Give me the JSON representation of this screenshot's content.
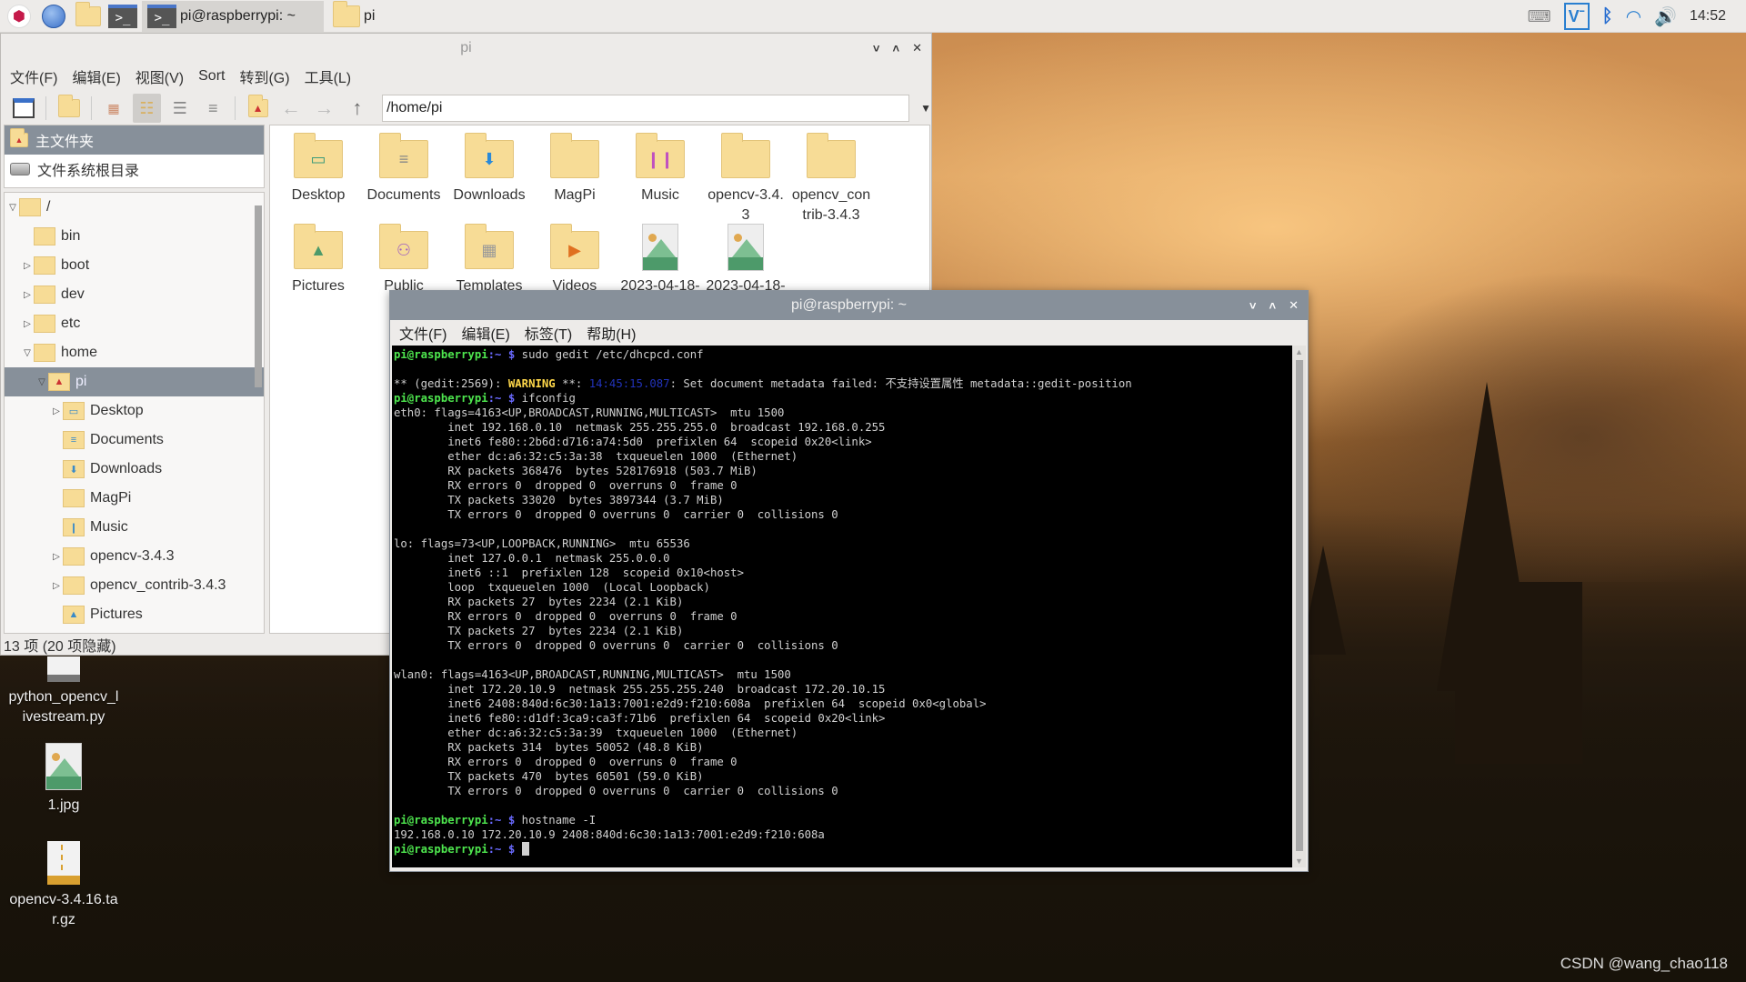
{
  "taskbar": {
    "tasks": [
      {
        "label": "pi@raspberrypi: ~",
        "icon": "terminal-icon",
        "active": true
      },
      {
        "label": "pi",
        "icon": "folder-icon",
        "active": false
      }
    ],
    "launchers": [
      "raspberry-menu-icon",
      "web-browser-icon",
      "file-manager-icon",
      "terminal-icon"
    ],
    "tray": [
      "keyboard-icon",
      "vnc-icon",
      "bluetooth-icon",
      "wifi-icon",
      "volume-icon"
    ],
    "clock": "14:52"
  },
  "file_manager": {
    "title": "pi",
    "menu": [
      "文件(F)",
      "编辑(E)",
      "视图(V)",
      "Sort",
      "转到(G)",
      "工具(L)"
    ],
    "path": "/home/pi",
    "places": [
      {
        "label": "主文件夹",
        "icon": "home-folder-icon",
        "selected": true
      },
      {
        "label": "文件系统根目录",
        "icon": "drive-icon",
        "selected": false
      }
    ],
    "tree": [
      {
        "label": "/",
        "expander": "open",
        "level": 0
      },
      {
        "label": "bin",
        "expander": "",
        "level": 1
      },
      {
        "label": "boot",
        "expander": "closed",
        "level": 1
      },
      {
        "label": "dev",
        "expander": "closed",
        "level": 1
      },
      {
        "label": "etc",
        "expander": "closed",
        "level": 1
      },
      {
        "label": "home",
        "expander": "open",
        "level": 1
      },
      {
        "label": "pi",
        "expander": "open",
        "level": 2,
        "selected": true
      },
      {
        "label": "Desktop",
        "expander": "closed",
        "level": 3
      },
      {
        "label": "Documents",
        "expander": "",
        "level": 3
      },
      {
        "label": "Downloads",
        "expander": "",
        "level": 3
      },
      {
        "label": "MagPi",
        "expander": "",
        "level": 3
      },
      {
        "label": "Music",
        "expander": "",
        "level": 3
      },
      {
        "label": "opencv-3.4.3",
        "expander": "closed",
        "level": 3
      },
      {
        "label": "opencv_contrib-3.4.3",
        "expander": "closed",
        "level": 3
      },
      {
        "label": "Pictures",
        "expander": "",
        "level": 3
      }
    ],
    "items": [
      {
        "label": "Desktop",
        "type": "folder"
      },
      {
        "label": "Documents",
        "type": "folder"
      },
      {
        "label": "Downloads",
        "type": "folder"
      },
      {
        "label": "MagPi",
        "type": "folder"
      },
      {
        "label": "Music",
        "type": "folder"
      },
      {
        "label": "opencv-3.4.\n3",
        "type": "folder"
      },
      {
        "label": "opencv_con\ntrib-3.4.3",
        "type": "folder"
      },
      {
        "label": "Pictures",
        "type": "folder"
      },
      {
        "label": "Public",
        "type": "folder"
      },
      {
        "label": "Templates",
        "type": "folder"
      },
      {
        "label": "Videos",
        "type": "folder"
      },
      {
        "label": "2023-04-18-",
        "type": "image"
      },
      {
        "label": "2023-04-18-",
        "type": "image"
      }
    ],
    "status": "13 项 (20 项隐藏)"
  },
  "terminal": {
    "title": "pi@raspberrypi: ~",
    "menu": [
      "文件(F)",
      "编辑(E)",
      "标签(T)",
      "帮助(H)"
    ],
    "prompt_user": "pi@raspberrypi",
    "prompt_path": ":~",
    "prompt_symbol": "$",
    "cmd1": " sudo gedit /etc/dhcpcd.conf",
    "warn_pre": "** (gedit:2569): ",
    "warn_word": "WARNING",
    "warn_mid": " **: ",
    "warn_time": "14:45:15.087",
    "warn_msg": ": Set document metadata failed: 不支持设置属性 metadata::gedit-position",
    "cmd2": " ifconfig",
    "output1": "eth0: flags=4163<UP,BROADCAST,RUNNING,MULTICAST>  mtu 1500\n        inet 192.168.0.10  netmask 255.255.255.0  broadcast 192.168.0.255\n        inet6 fe80::2b6d:d716:a74:5d0  prefixlen 64  scopeid 0x20<link>\n        ether dc:a6:32:c5:3a:38  txqueuelen 1000  (Ethernet)\n        RX packets 368476  bytes 528176918 (503.7 MiB)\n        RX errors 0  dropped 0  overruns 0  frame 0\n        TX packets 33020  bytes 3897344 (3.7 MiB)\n        TX errors 0  dropped 0 overruns 0  carrier 0  collisions 0\n\nlo: flags=73<UP,LOOPBACK,RUNNING>  mtu 65536\n        inet 127.0.0.1  netmask 255.0.0.0\n        inet6 ::1  prefixlen 128  scopeid 0x10<host>\n        loop  txqueuelen 1000  (Local Loopback)\n        RX packets 27  bytes 2234 (2.1 KiB)\n        RX errors 0  dropped 0  overruns 0  frame 0\n        TX packets 27  bytes 2234 (2.1 KiB)\n        TX errors 0  dropped 0 overruns 0  carrier 0  collisions 0\n\nwlan0: flags=4163<UP,BROADCAST,RUNNING,MULTICAST>  mtu 1500\n        inet 172.20.10.9  netmask 255.255.255.240  broadcast 172.20.10.15\n        inet6 2408:840d:6c30:1a13:7001:e2d9:f210:608a  prefixlen 64  scopeid 0x0<global>\n        inet6 fe80::d1df:3ca9:ca3f:71b6  prefixlen 64  scopeid 0x20<link>\n        ether dc:a6:32:c5:3a:39  txqueuelen 1000  (Ethernet)\n        RX packets 314  bytes 50052 (48.8 KiB)\n        RX errors 0  dropped 0  overruns 0  frame 0\n        TX packets 470  bytes 60501 (59.0 KiB)\n        TX errors 0  dropped 0 overruns 0  carrier 0  collisions 0\n",
    "cmd3": " hostname -I",
    "output2": "192.168.0.10 172.20.10.9 2408:840d:6c30:1a13:7001:e2d9:f210:608a"
  },
  "desktop": {
    "icons": [
      {
        "label": "python_opencv_l\nivestream.py",
        "type": "text-file"
      },
      {
        "label": "1.jpg",
        "type": "image"
      },
      {
        "label": "opencv-3.4.16.ta\nr.gz",
        "type": "archive"
      }
    ],
    "watermark": "CSDN @wang_chao118"
  },
  "colors": {
    "selection": "#87909a",
    "prompt_green": "#4ee64e",
    "prompt_blue": "#6a6aff",
    "warning_yellow": "#ffd84a",
    "folder": "#f7dc96"
  }
}
